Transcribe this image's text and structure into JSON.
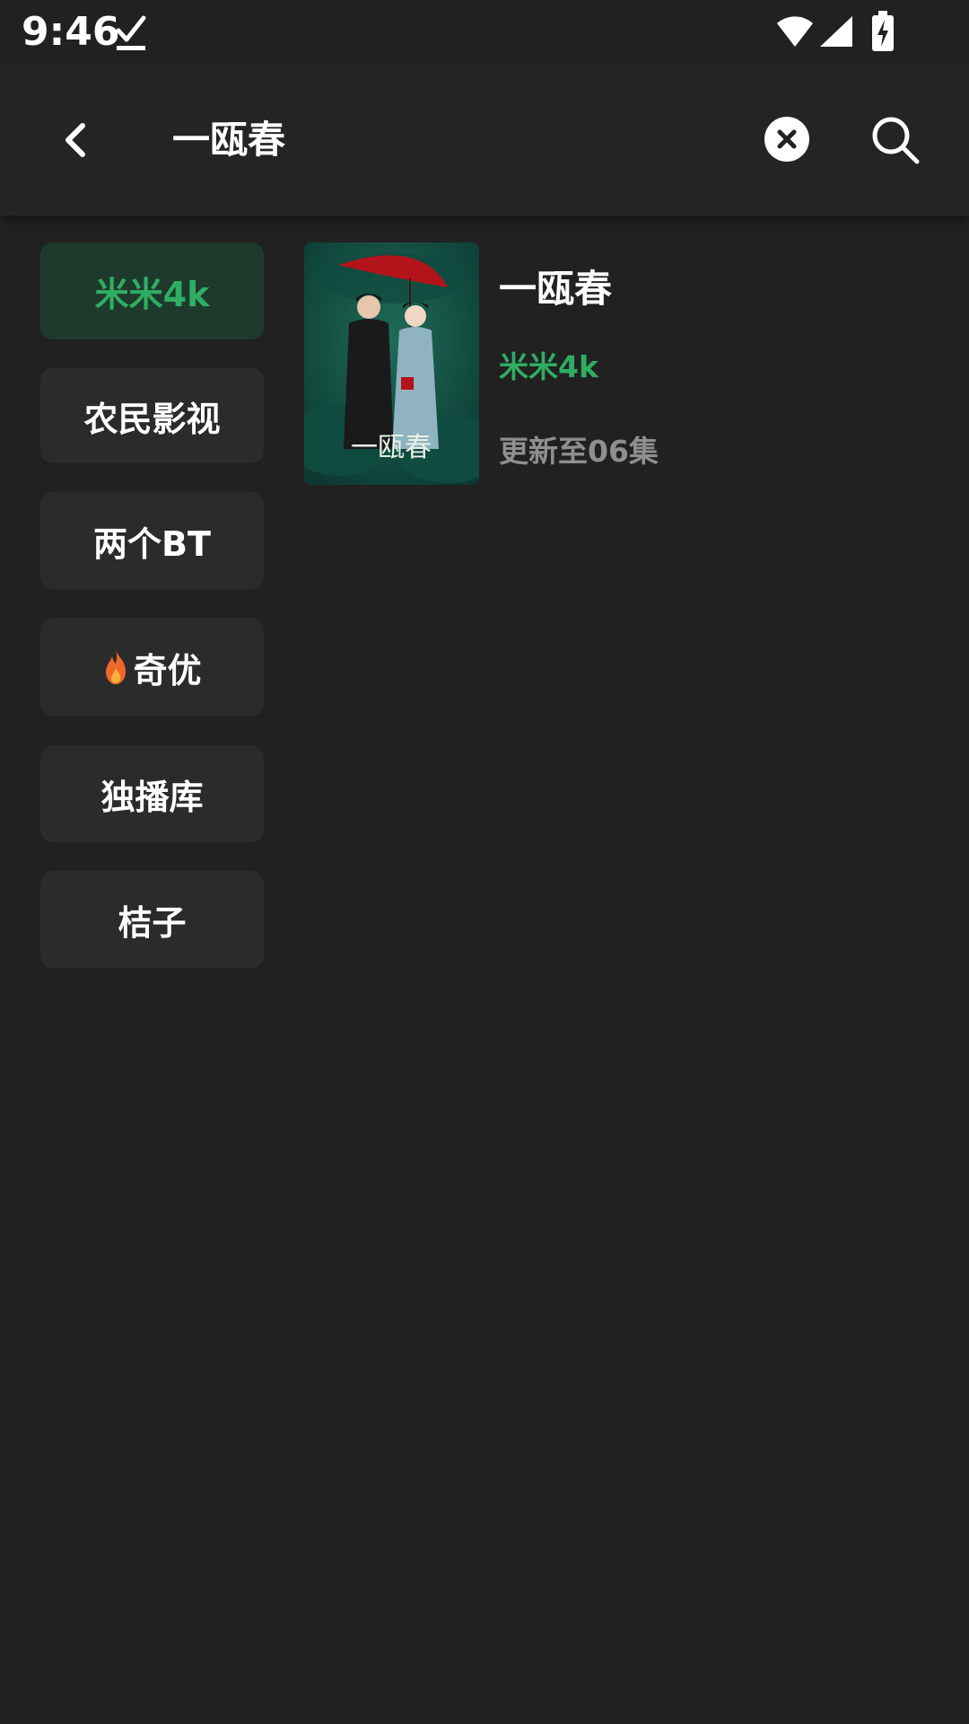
{
  "status_bar": {
    "time": "9:46"
  },
  "app_bar": {
    "search_query": "一瓯春"
  },
  "sources": [
    {
      "label": "米米4k",
      "active": true
    },
    {
      "label": "农民影视",
      "active": false
    },
    {
      "label": "两个BT",
      "active": false
    },
    {
      "label": "奇优",
      "active": false,
      "icon": "flame-icon"
    },
    {
      "label": "独播库",
      "active": false
    },
    {
      "label": "桔子",
      "active": false
    }
  ],
  "result": {
    "title": "一瓯春",
    "source": "米米4k",
    "status": "更新至06集",
    "poster_title": "一瓯春"
  },
  "colors": {
    "background": "#212121",
    "accent": "#2fae63",
    "active_source_bg": "#1e3a2c",
    "muted_text": "#8f8f8f"
  }
}
